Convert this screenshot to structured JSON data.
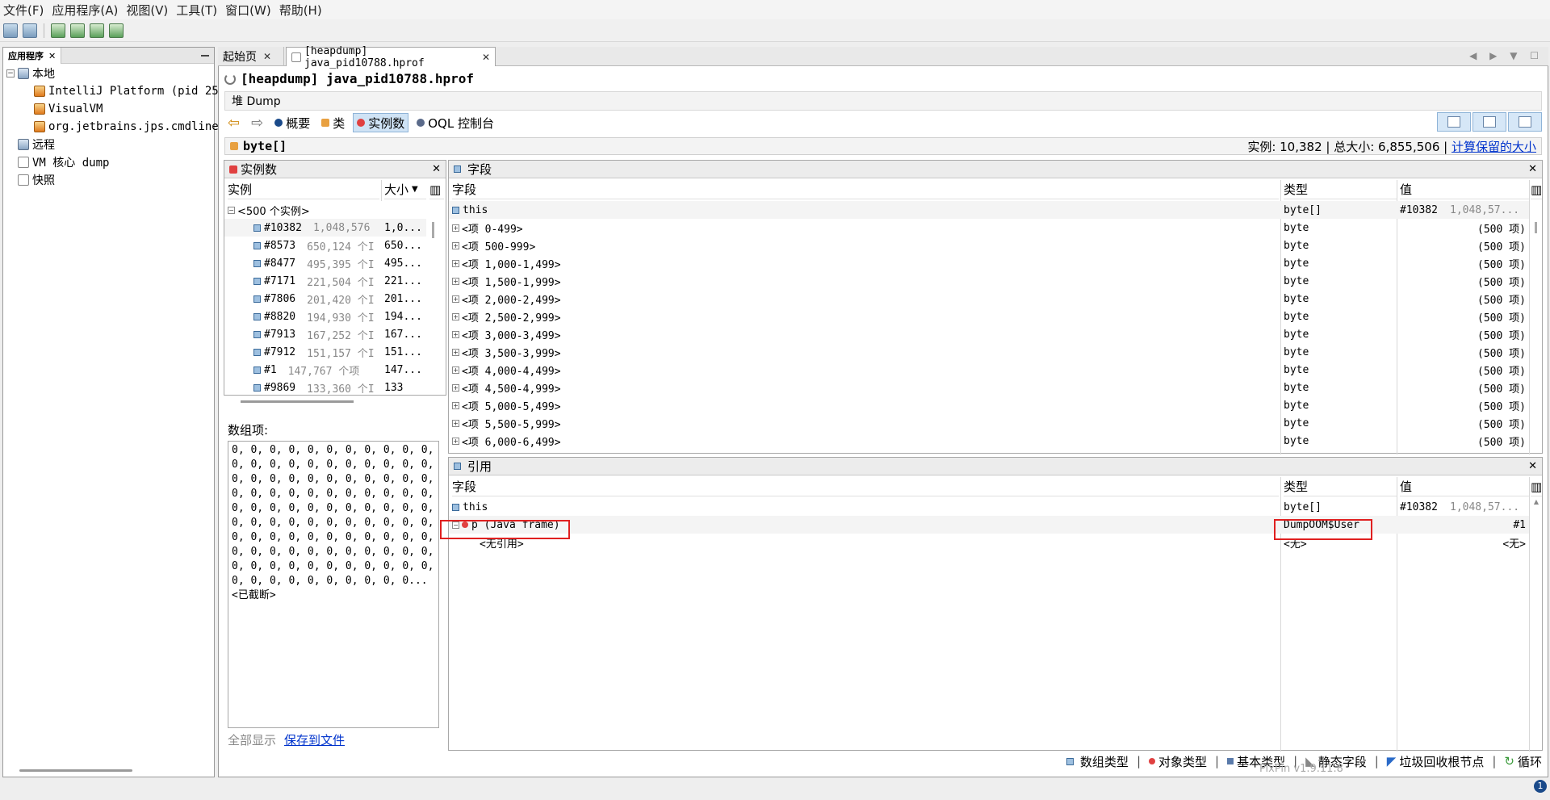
{
  "menu": [
    "文件(F)",
    "应用程序(A)",
    "视图(V)",
    "工具(T)",
    "窗口(W)",
    "帮助(H)"
  ],
  "left_panel": {
    "tab": "应用程序",
    "tree": {
      "local": "本地",
      "intellij": "IntelliJ Platform (pid 25",
      "visualvm": "VisualVM",
      "jps": "org.jetbrains.jps.cmdline.",
      "remote": "远程",
      "vm_core": "VM 核心 dump",
      "snapshot": "快照"
    }
  },
  "tabs": {
    "start": "起始页",
    "heapdump": "[heapdump] java_pid10788.hprof"
  },
  "title": "[heapdump] java_pid10788.hprof",
  "dump_label": "堆 Dump",
  "views": {
    "summary": "概要",
    "classes": "类",
    "instances": "实例数",
    "oql": "OQL 控制台"
  },
  "class_bar": {
    "name": "byte[]",
    "stats_prefix": "实例: 10,382 | 总大小: 6,855,506 |",
    "calc_link": "计算保留的大小"
  },
  "instances_pane": {
    "title": "实例数",
    "col_instance": "实例",
    "col_size": "大小",
    "group": "<500 个实例>",
    "rows": [
      {
        "id": "#10382",
        "items": "1,048,576",
        "size": "1,0..."
      },
      {
        "id": "#8573",
        "items": "650,124 个I",
        "size": "650..."
      },
      {
        "id": "#8477",
        "items": "495,395 个I",
        "size": "495..."
      },
      {
        "id": "#7171",
        "items": "221,504 个I",
        "size": "221..."
      },
      {
        "id": "#7806",
        "items": "201,420 个I",
        "size": "201..."
      },
      {
        "id": "#8820",
        "items": "194,930 个I",
        "size": "194..."
      },
      {
        "id": "#7913",
        "items": "167,252 个I",
        "size": "167..."
      },
      {
        "id": "#7912",
        "items": "151,157 个I",
        "size": "151..."
      },
      {
        "id": "#1",
        "items": "147,767 个项",
        "size": "147..."
      },
      {
        "id": "#9869",
        "items": "133,360 个I",
        "size": "133"
      }
    ]
  },
  "array_items": {
    "label": "数组项:",
    "text": "0, 0, 0, 0, 0, 0, 0, 0, 0, 0, 0, 0, 0, 0, 0, 0, 0, 0, 0, 0, 0, 0, 0, 0, 0, 0, 0, 0, 0, 0, 0, 0, 0, 0, 0, 0, 0, 0, 0, 0, 0, 0, 0, 0, 0, 0, 0, 0, 0, 0, 0, 0, 0, 0, 0, 0, 0, 0, 0, 0, 0, 0, 0, 0, 0, 0, 0, 0, 0, 0, 0, 0, 0, 0, 0, 0, 0, 0, 0, 0, 0, 0, 0, 0, 0, 0, 0, 0, 0, 0, 0, 0, 0, 0, 0, 0, 0, 0, 0, 0, 0, 0, 0, 0, 0, 0, 0, 0, 0... <已截断>",
    "show_all": "全部显示",
    "save_link": "保存到文件"
  },
  "fields_pane": {
    "title": "字段",
    "col_field": "字段",
    "col_type": "类型",
    "col_value": "值",
    "this_row": {
      "name": "this",
      "type": "byte[]",
      "value": "#10382",
      "extra": "1,048,57..."
    },
    "rows": [
      {
        "name": "<项 0-499>",
        "type": "byte",
        "value": "(500 项)"
      },
      {
        "name": "<项 500-999>",
        "type": "byte",
        "value": "(500 项)"
      },
      {
        "name": "<项 1,000-1,499>",
        "type": "byte",
        "value": "(500 项)"
      },
      {
        "name": "<项 1,500-1,999>",
        "type": "byte",
        "value": "(500 项)"
      },
      {
        "name": "<项 2,000-2,499>",
        "type": "byte",
        "value": "(500 项)"
      },
      {
        "name": "<项 2,500-2,999>",
        "type": "byte",
        "value": "(500 项)"
      },
      {
        "name": "<项 3,000-3,499>",
        "type": "byte",
        "value": "(500 项)"
      },
      {
        "name": "<项 3,500-3,999>",
        "type": "byte",
        "value": "(500 项)"
      },
      {
        "name": "<项 4,000-4,499>",
        "type": "byte",
        "value": "(500 项)"
      },
      {
        "name": "<项 4,500-4,999>",
        "type": "byte",
        "value": "(500 项)"
      },
      {
        "name": "<项 5,000-5,499>",
        "type": "byte",
        "value": "(500 项)"
      },
      {
        "name": "<项 5,500-5,999>",
        "type": "byte",
        "value": "(500 项)"
      },
      {
        "name": "<项 6,000-6,499>",
        "type": "byte",
        "value": "(500 项)"
      }
    ]
  },
  "refs_pane": {
    "title": "引用",
    "col_field": "字段",
    "col_type": "类型",
    "col_value": "值",
    "this_row": {
      "name": "this",
      "type": "byte[]",
      "value": "#10382",
      "extra": "1,048,57..."
    },
    "p_row": {
      "name": "p (Java frame)",
      "type": "DumpOOM$User",
      "value": "#1"
    },
    "noref_row": {
      "name": "<无引用>",
      "type": "<无>",
      "value": "<无>"
    }
  },
  "legend": {
    "array": "数组类型",
    "object": "对象类型",
    "primitive": "基本类型",
    "static": "静态字段",
    "gcroot": "垃圾回收根节点",
    "loop": "循环"
  },
  "watermark": "PixPin v1.9.11.8",
  "notif_badge": "1",
  "colors": {
    "highlight": "#e02020",
    "selection": "#cfe3f5",
    "link": "#0033cc"
  }
}
